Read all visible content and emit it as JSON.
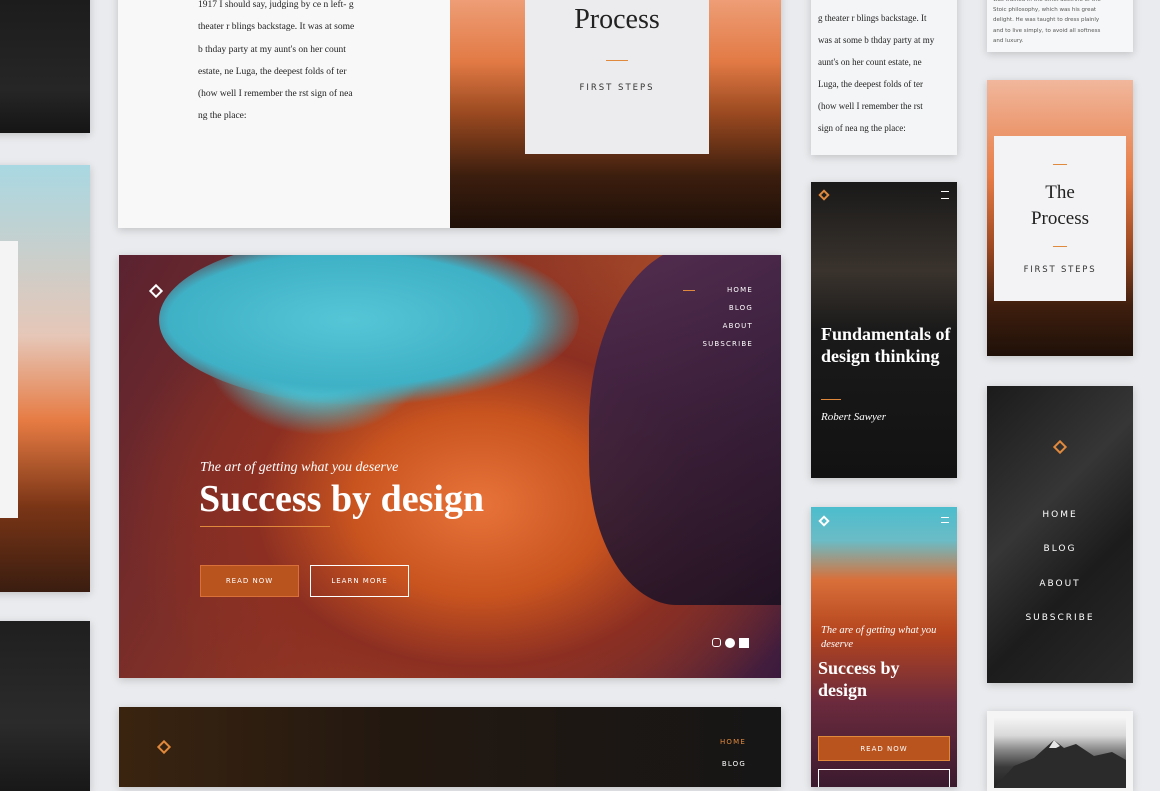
{
  "colors": {
    "accent": "#e0883c",
    "page_bg": "#e9ebee",
    "dark_card": "#121212",
    "button_fill": "#b9541f"
  },
  "book_card": {
    "lines": "1917 I should say, judging by ce  n left- g\ntheater r blings backstage. It was at some\nb thday party at my aunt's on her count\nestate, ne  Luga,   the deepest folds of  ter\n(how well I remember the  rst sign of nea\nng the place:",
    "process_title": "Process",
    "process_sub": "FIRST STEPS"
  },
  "hero": {
    "tagline": "The art of getting what you deserve",
    "title": "Success by design",
    "read_more": "READ NOW",
    "learn_more": "LEARN MORE",
    "nav": [
      "HOME",
      "BLOG",
      "ABOUT",
      "SUBSCRIBE"
    ],
    "logo": "diamond-logo-icon",
    "social": [
      "instagram-icon",
      "pinterest-icon",
      "facebook-icon"
    ]
  },
  "bottom_bar": {
    "nav": [
      "HOME",
      "BLOG"
    ]
  },
  "phone_text": {
    "lines": "g theater r blings backstage. It\nwas at some b thday party at my\naunt's on her count  estate, ne\nLuga,   the deepest folds of  ter\n(how well I remember the  rst\nsign of nea ng the place:"
  },
  "phone_fund": {
    "title": "Fundamentals of design thinking",
    "author": "Robert Sawyer"
  },
  "phone_hero": {
    "tagline": "The are of getting what you deserve",
    "title": "Success by design",
    "button": "READ NOW"
  },
  "right_text": {
    "lines": "was trained in the strict doctrine of the\nStoic philosophy, which was his great\ndelight. He was taught to dress plainly\nand to live simply, to avoid all softness\nand luxury."
  },
  "right_process": {
    "title": "The Process",
    "sub": "FIRST STEPS"
  },
  "right_menu": {
    "items": [
      "HOME",
      "BLOG",
      "ABOUT",
      "SUBSCRIBE"
    ]
  }
}
